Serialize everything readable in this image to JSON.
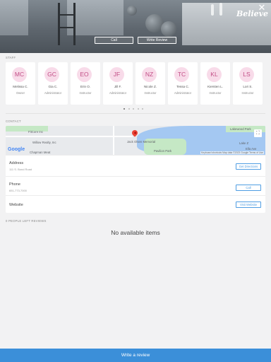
{
  "hero": {
    "call_label": "Call",
    "write_review_label": "Write Review",
    "banner_text": "Believe"
  },
  "staff": {
    "section_title": "STAFF",
    "members": [
      {
        "initials": "MC",
        "name": "Melissa C.",
        "role": "Owner"
      },
      {
        "initials": "GC",
        "name": "Gia C.",
        "role": "Administrator"
      },
      {
        "initials": "EO",
        "name": "Erin O.",
        "role": "Instructor"
      },
      {
        "initials": "JF",
        "name": "Jill F.",
        "role": "Administrator"
      },
      {
        "initials": "NZ",
        "name": "Nicole Z.",
        "role": "Instructor"
      },
      {
        "initials": "TC",
        "name": "Tessa C.",
        "role": "Administrator"
      },
      {
        "initials": "KL",
        "name": "Kiersten L.",
        "role": "Instructor"
      },
      {
        "initials": "LS",
        "name": "Lori S.",
        "role": "Instructor"
      }
    ],
    "page_count": 5,
    "active_page": 0
  },
  "contact": {
    "section_title": "CONTACT",
    "map": {
      "labels": [
        "FitCore Inc",
        "Willow Realty, Inc",
        "Chapman Meat",
        "Lakewood Park",
        "Jack Olsen Memorial",
        "Pavilion Park",
        "Lake Z",
        "Ella Ave"
      ],
      "attribution": "Keyboard shortcuts  Map data ©2023 Google  Terms of Use",
      "google": "Google"
    },
    "address": {
      "label": "Address",
      "value": "111 S. Bond Road",
      "action": "Get Directions"
    },
    "phone": {
      "label": "Phone",
      "value": "651-773-7000",
      "action": "Call"
    },
    "website": {
      "label": "Website",
      "action": "Visit Website"
    }
  },
  "reviews": {
    "section_title": "0 PEOPLE LEFT REVIEWS",
    "empty_text": "No available items"
  },
  "footer": {
    "write_review_label": "Write a review"
  },
  "colors": {
    "accent": "#3b8fd9",
    "avatar_bg": "#f8dbe9",
    "avatar_text": "#c24e86"
  }
}
